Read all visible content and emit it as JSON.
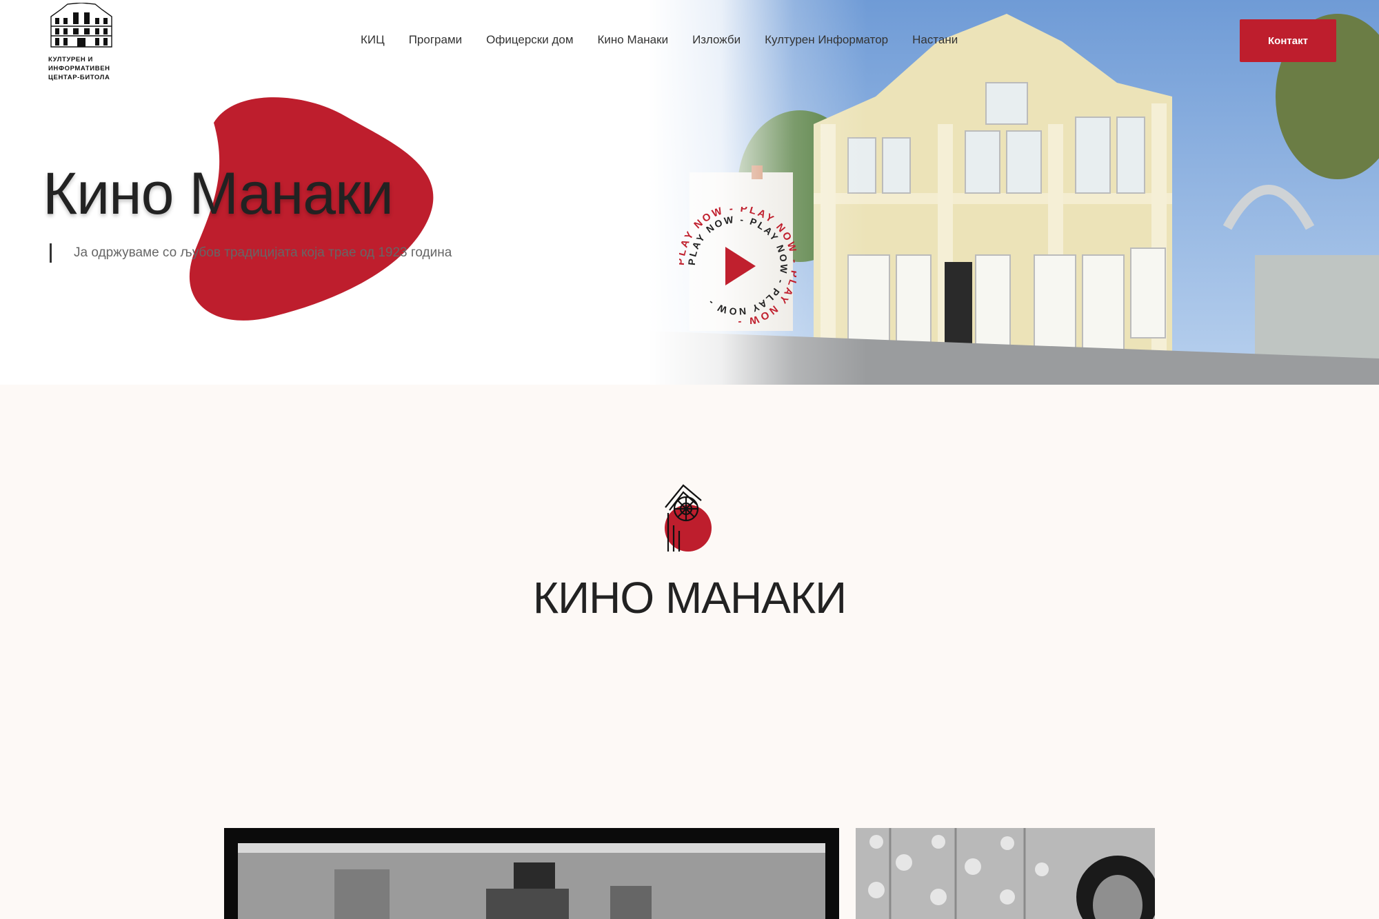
{
  "logo": {
    "lines": [
      "КУЛТУРЕН И",
      "ИНФОРМАТИВЕН",
      "ЦЕНТАР-БИТОЛА"
    ]
  },
  "nav": {
    "items": [
      {
        "label": "КИЦ"
      },
      {
        "label": "Програми"
      },
      {
        "label": "Офицерски дом"
      },
      {
        "label": "Кино Манаки"
      },
      {
        "label": "Изложби"
      },
      {
        "label": "Културен Информатор"
      },
      {
        "label": "Настани"
      }
    ],
    "contact_label": "Контакт"
  },
  "hero": {
    "title": "Кино Манаки",
    "subtitle": "Ја одржуваме со љубов традицијата која трае од 1923 година",
    "play_text": "PLAY NOW - PLAY NOW - PLAY NOW - "
  },
  "section": {
    "title": "КИНО МАНАКИ"
  },
  "colors": {
    "accent": "#be1e2d",
    "background": "#fdf9f6",
    "text": "#222222"
  },
  "icons": [
    "building-logo-icon",
    "play-icon",
    "cinema-emblem-icon"
  ]
}
